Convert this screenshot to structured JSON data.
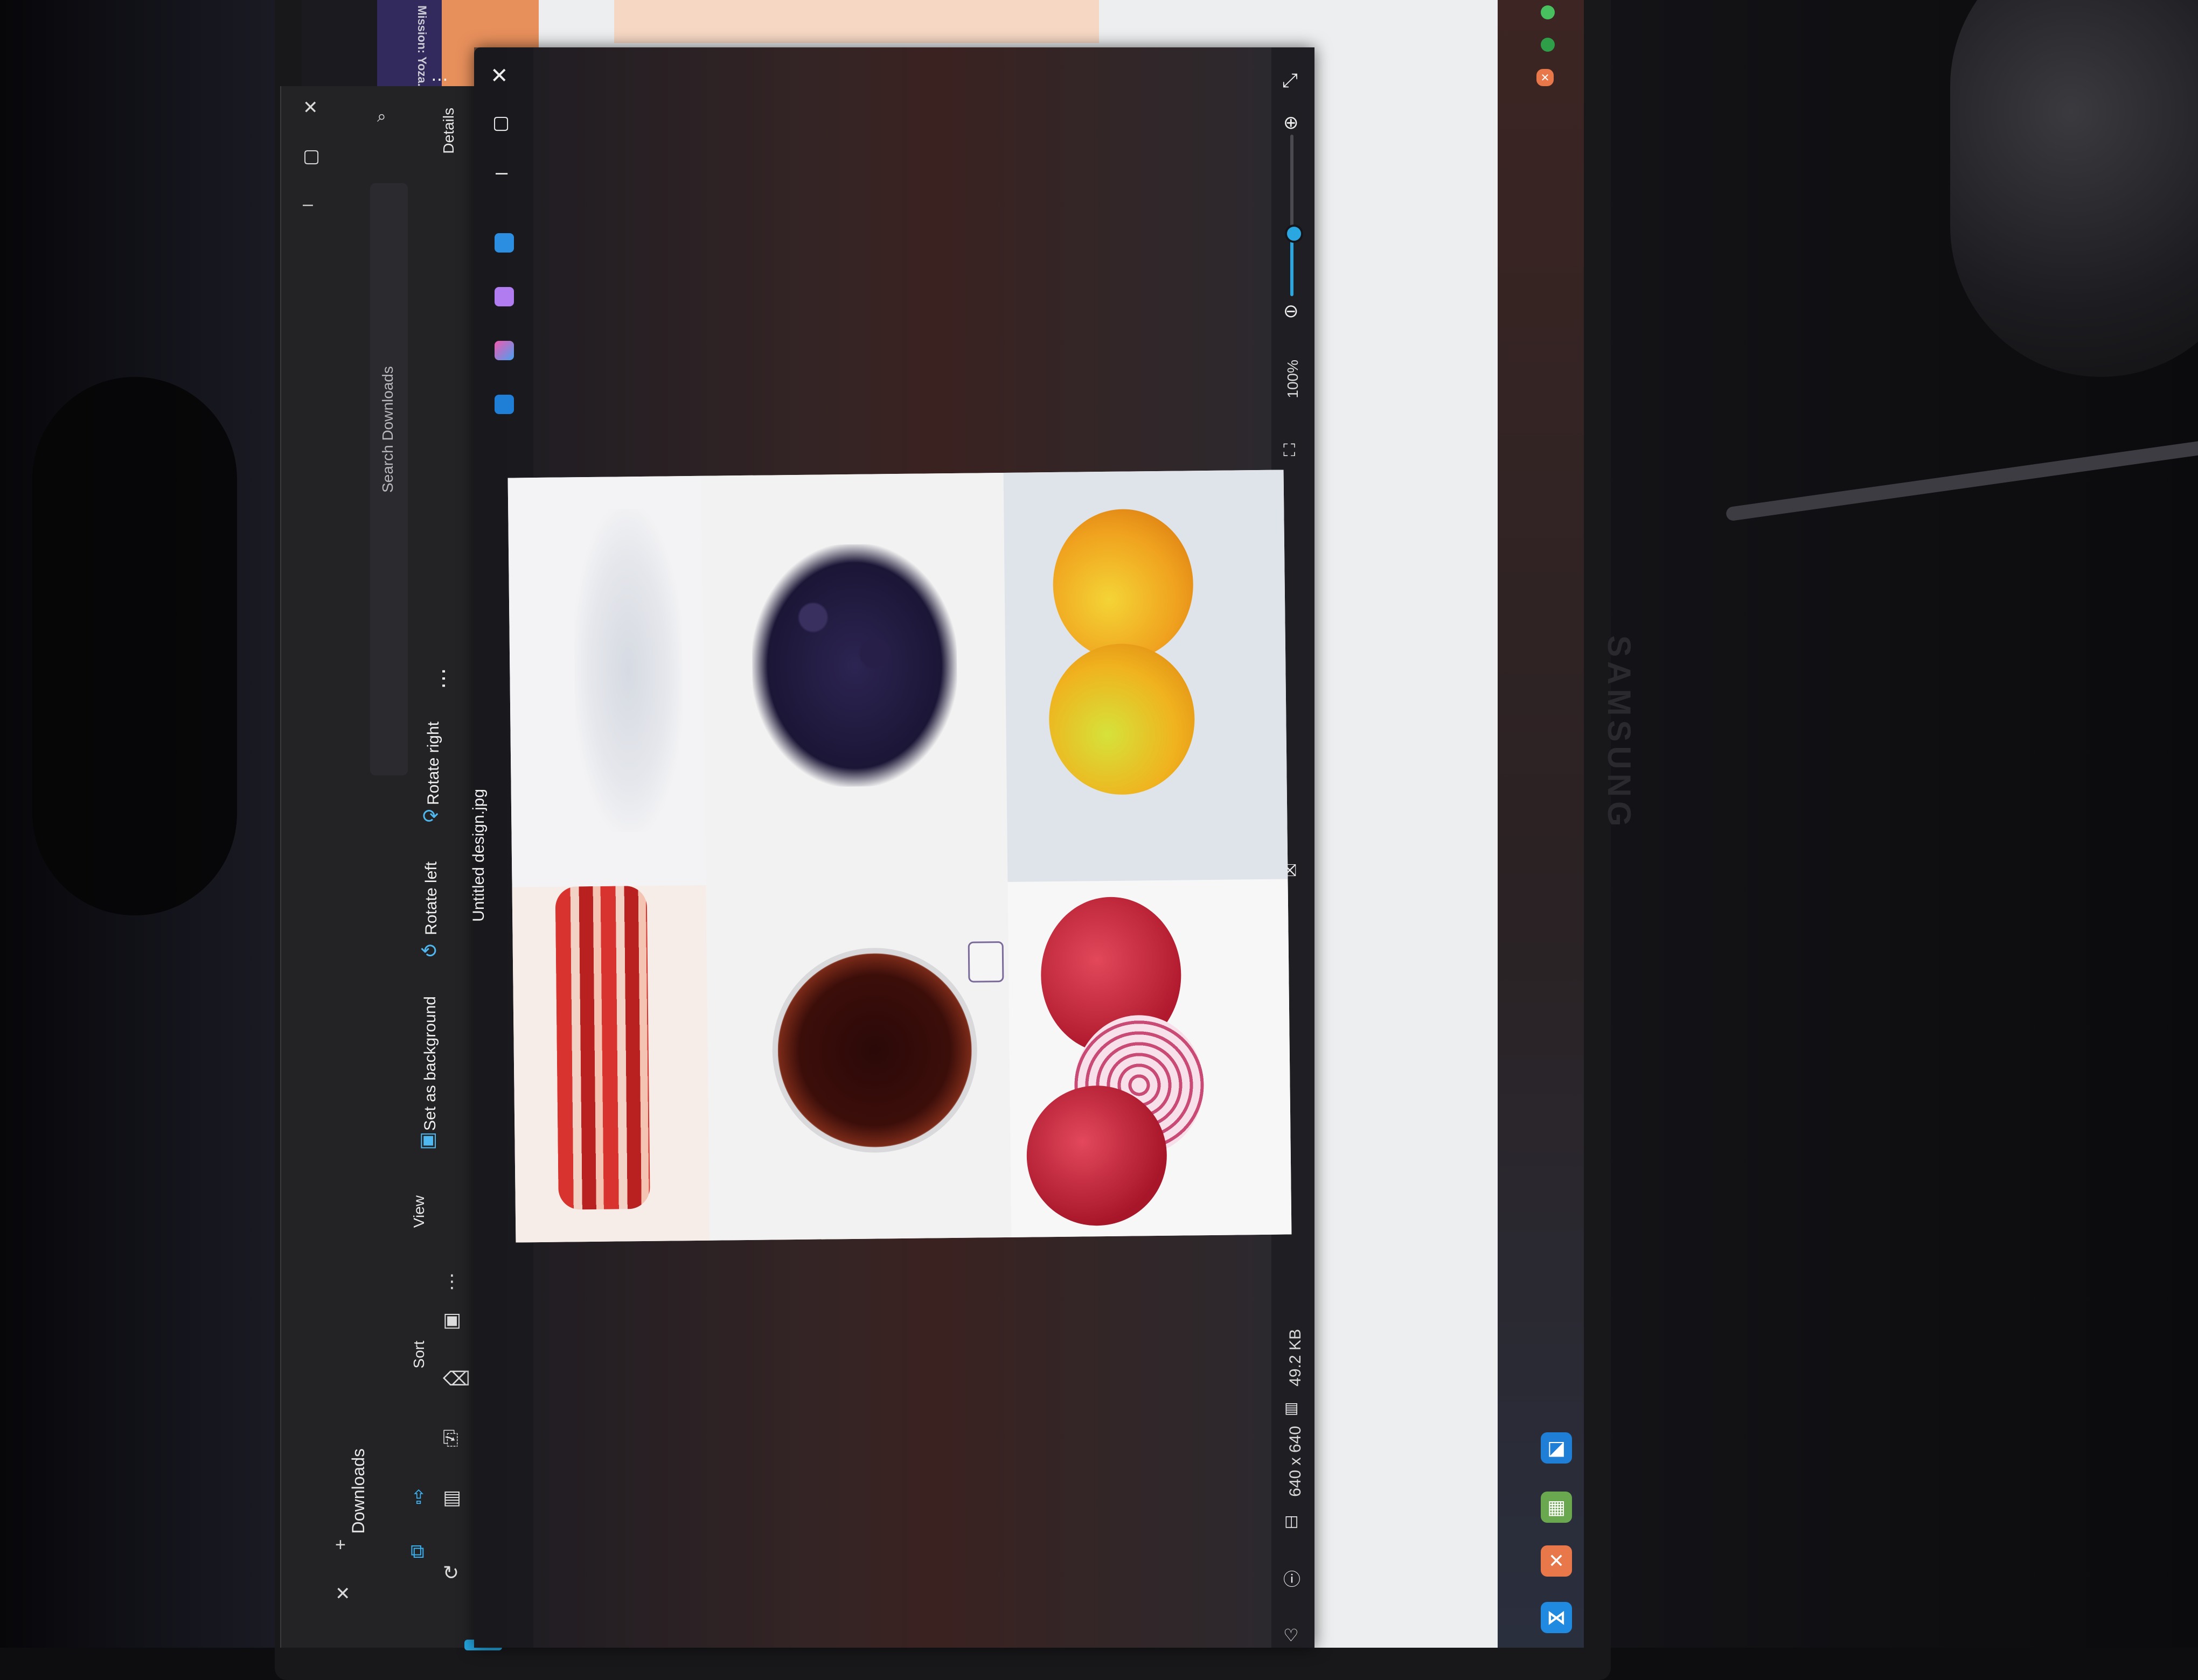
{
  "background_tab": {
    "title": "Mission: Yoza..."
  },
  "explorer": {
    "location": "Downloads",
    "search_placeholder": "Search Downloads",
    "details_label": "Details",
    "sort_label": "Sort",
    "view_label": "View"
  },
  "viewer": {
    "file_name": "Untitled design.jpg",
    "toolbar": {
      "set_as_background": "Set as background",
      "rotate_left": "Rotate left",
      "rotate_right": "Rotate right"
    },
    "zoom_level": "100%",
    "zoom_fraction": 0.4,
    "dimensions": "640 x 640",
    "file_size": "49.2 KB"
  },
  "image_cells": [
    "bacon",
    "salt",
    "soy-sauce",
    "peppercorns",
    "red-onions",
    "calamansi"
  ],
  "colors": {
    "accent": "#2aa7e0",
    "viewer_bg": "#2b2326",
    "explorer_bg": "#232326"
  },
  "monitor_brand": "SAMSUNG"
}
